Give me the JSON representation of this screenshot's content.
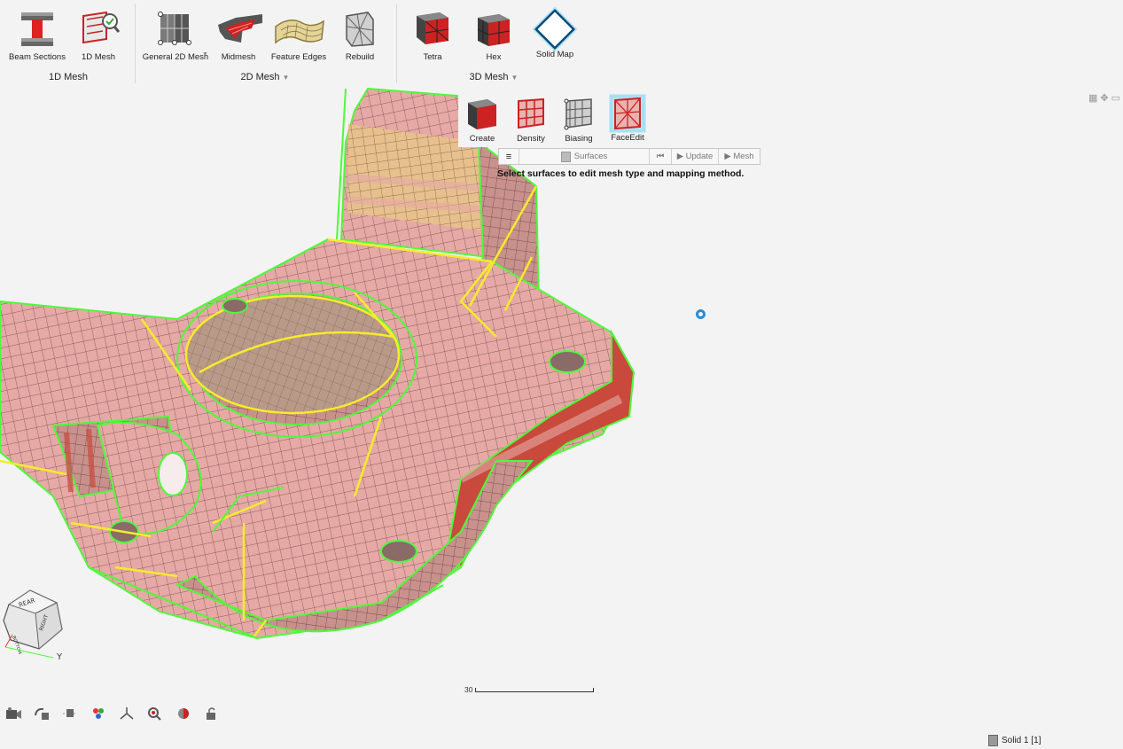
{
  "ribbon": {
    "groups": {
      "mesh1d": {
        "label": "1D Mesh",
        "tools": {
          "beam_sections": "Beam Sections",
          "mesh_1d": "1D Mesh"
        }
      },
      "mesh2d": {
        "label": "2D Mesh",
        "tools": {
          "general_2d": "General 2D Mesh",
          "midmesh": "Midmesh",
          "feature_edges": "Feature Edges",
          "rebuild": "Rebuild"
        }
      },
      "mesh3d": {
        "label": "3D Mesh",
        "tools": {
          "tetra": "Tetra",
          "hex": "Hex",
          "solid_map": "Solid Map"
        }
      }
    },
    "subtools": {
      "create": "Create",
      "density": "Density",
      "biasing": "Biasing",
      "face_edit": "FaceEdit"
    }
  },
  "guidebar": {
    "menu_icon": "menu-icon",
    "surfaces": "Surfaces",
    "first_icon": "skip-back-icon",
    "update": "▶ Update",
    "mesh": "▶ Mesh"
  },
  "hint": "Select surfaces to edit mesh type and mapping method.",
  "viewcube": {
    "top": "REAR",
    "right": "RIGHT",
    "left": "BOTTOM",
    "axis": "Y"
  },
  "scale_bar": {
    "value": "30"
  },
  "status": {
    "entity": "Solid 1  [1]"
  },
  "colors": {
    "mesh_fill": "#e6a9a5",
    "mesh_line": "#5a3f3f",
    "feature_edge": "#4dfa3a",
    "surface_edge": "#f6ec2a",
    "selected_surface": "#e7c08e",
    "highlight": "#c94a3c",
    "accent": "#2a8ad8"
  },
  "bottom_toolbar": [
    "camera-icon",
    "rotate-icon",
    "section-icon",
    "color-icon",
    "axis-icon",
    "zoom-icon",
    "render-icon",
    "lock-icon"
  ]
}
